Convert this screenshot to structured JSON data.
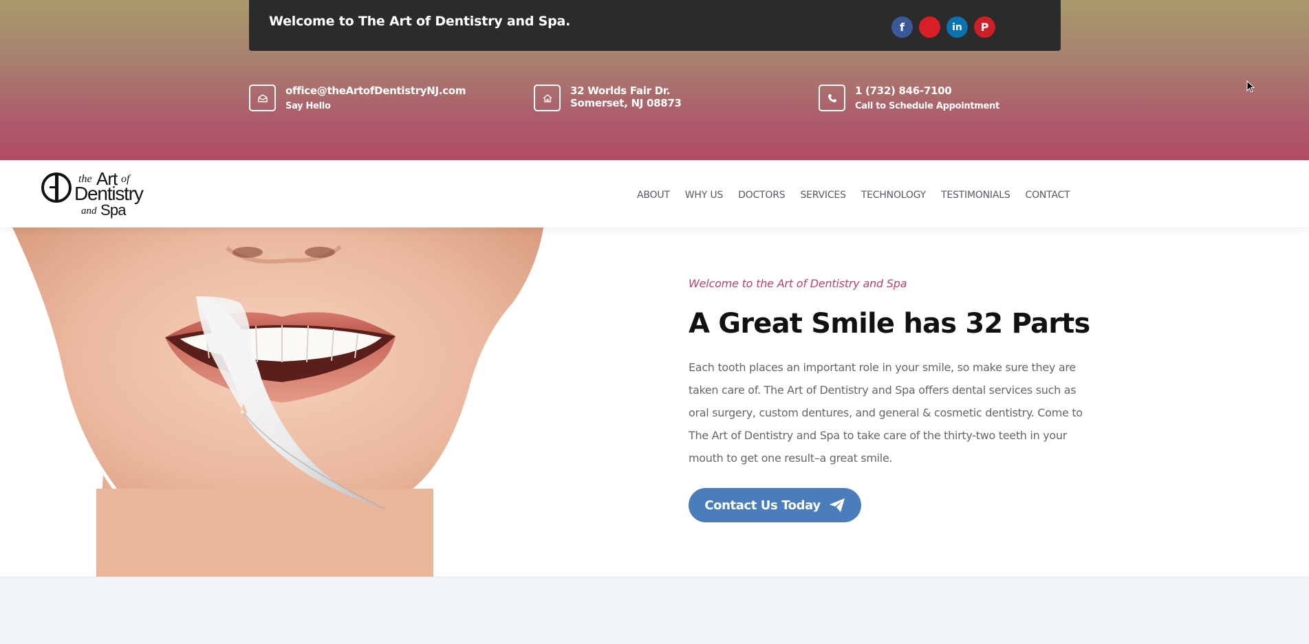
{
  "topbar": {
    "welcome": "Welcome to The Art of Dentistry and Spa.",
    "social": [
      {
        "icon": "facebook-icon",
        "glyph": "f",
        "color": "#3b5998"
      },
      {
        "icon": "youtube-icon",
        "glyph": "",
        "color": "#d91f26"
      },
      {
        "icon": "linkedin-icon",
        "glyph": "in",
        "color": "#0a72b1"
      },
      {
        "icon": "pinterest-icon",
        "glyph": "P",
        "color": "#cb2027"
      }
    ]
  },
  "contact_info": {
    "email": {
      "icon": "envelope-icon",
      "main": "office@theArtofDentistryNJ.com",
      "sub": "Say Hello"
    },
    "address": {
      "icon": "home-icon",
      "line1": "32 Worlds Fair Dr.",
      "line2": "Somerset, NJ 08873"
    },
    "phone": {
      "icon": "phone-icon",
      "main": "1 (732) 846-7100",
      "sub": "Call to Schedule Appointment"
    }
  },
  "header": {
    "logo": {
      "line1": "the",
      "line2": "Art",
      "line3": "of",
      "line4": "Dentistry",
      "line5": "and",
      "line6": "Spa"
    },
    "nav": [
      "ABOUT",
      "WHY US",
      "DOCTORS",
      "SERVICES",
      "TECHNOLOGY",
      "TESTIMONIALS",
      "CONTACT"
    ]
  },
  "hero": {
    "kicker": "Welcome to the Art of Dentistry and Spa",
    "headline": "A Great Smile has 32 Parts",
    "body_lines": [
      "Each tooth places an important role in your smile, so make sure they are",
      "taken care of. The Art of Dentistry and Spa offers dental services such as",
      "oral surgery, custom dentures, and general & cosmetic dentistry. Come to",
      "The Art of Dentistry and Spa to take care of the thirty-two teeth in your",
      "mouth to get one result–a great smile."
    ],
    "cta_label": "Contact Us Today",
    "cta_icon": "paper-plane-icon"
  },
  "colors": {
    "accent_blue": "#4a7ebb",
    "kicker": "#b0466a",
    "welcome_bar": "#2b2b2b"
  }
}
